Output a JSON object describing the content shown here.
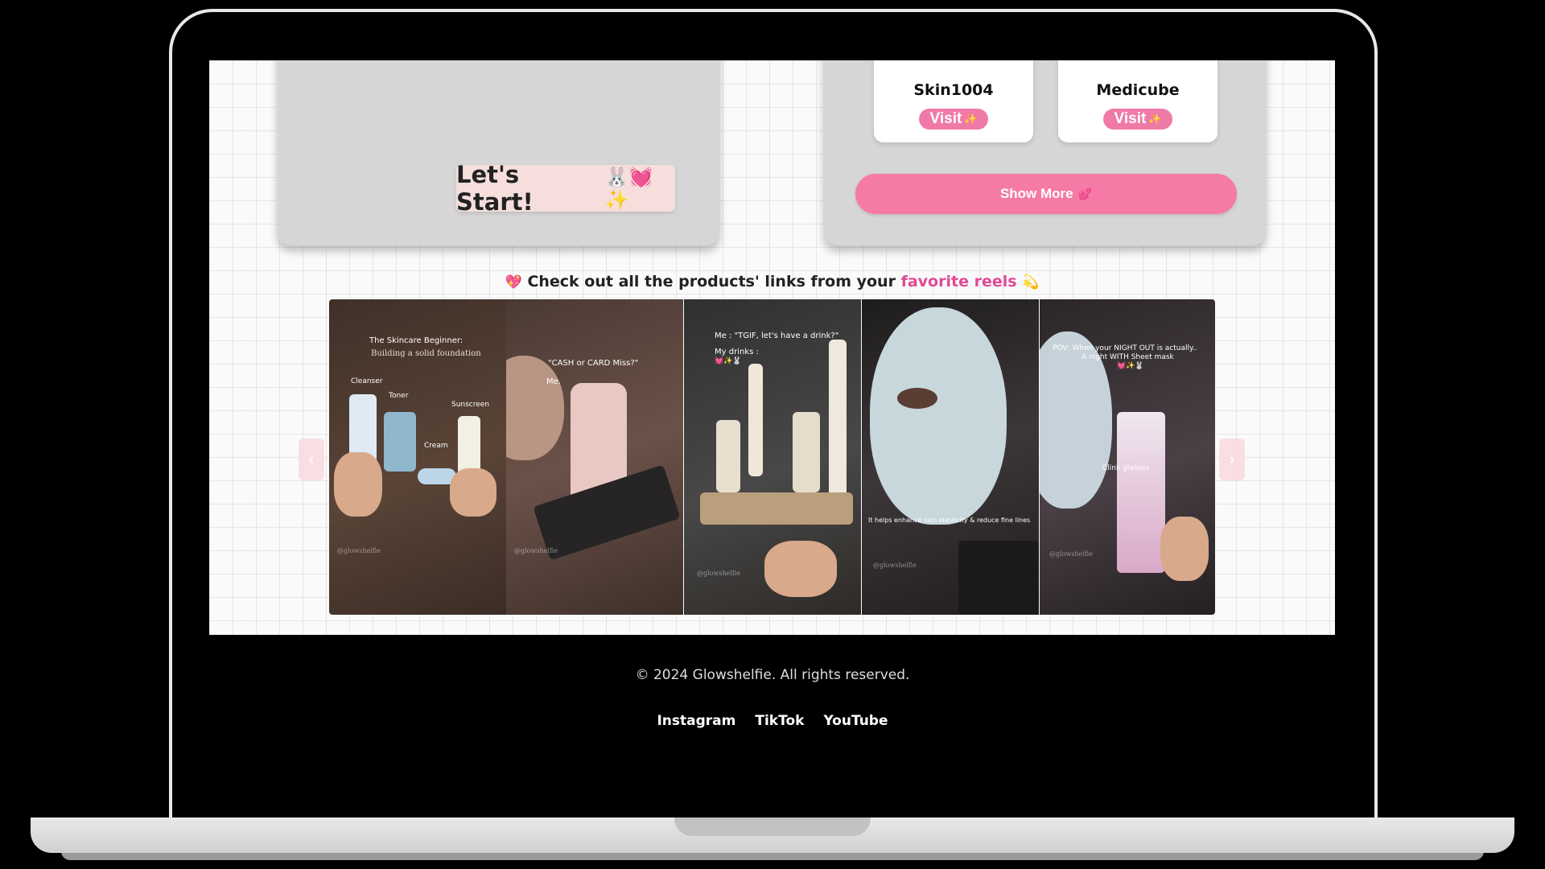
{
  "hero": {
    "start_label": "Let's Start!",
    "start_emoji": "🐰💓✨"
  },
  "brands": [
    {
      "name": "Skin1004",
      "visit_label": "Visit",
      "visit_emoji": "✨"
    },
    {
      "name": "Medicube",
      "visit_label": "Visit",
      "visit_emoji": "✨"
    }
  ],
  "show_more": {
    "label": "Show More",
    "emoji": "💕"
  },
  "reels_section": {
    "emoji_left": "💖",
    "heading_prefix": "Check out all the products' links from your",
    "heading_highlight": "favorite reels",
    "emoji_right": "💫"
  },
  "reels": [
    {
      "title": "The Skincare Beginner:",
      "subtitle": "Building a solid foundation",
      "labels": [
        "Cleanser",
        "Toner",
        "Sunscreen",
        "Cream"
      ],
      "watermark": "@glowshelfie"
    },
    {
      "title": "\"CASH or CARD Miss?\"",
      "label": "Me.",
      "watermark": "@glowshelfie"
    },
    {
      "title": "Me : \"TGIF, let's have a drink?\"",
      "label": "My drinks :",
      "emoji": "💓✨🐰",
      "watermark": "@glowshelfie"
    },
    {
      "caption": "It helps enhance skin elasticity & reduce fine lines",
      "watermark": "@glowshelfie"
    },
    {
      "title": "POV; When your NIGHT OUT is actually..",
      "subtitle": "A night WITH Sheet mask",
      "emoji": "💓✨🐰",
      "label": "Clink glasses",
      "watermark": "@glowshelfie"
    }
  ],
  "carousel": {
    "prev_label": "‹",
    "next_label": "›"
  },
  "footer": {
    "copyright": "© 2024 Glowshelfie. All rights reserved.",
    "links": [
      "Instagram",
      "TikTok",
      "YouTube"
    ]
  },
  "colors": {
    "accent_pink": "#f57aa6",
    "highlight_pink": "#e04a95",
    "card_gray": "#d6d6d6"
  }
}
